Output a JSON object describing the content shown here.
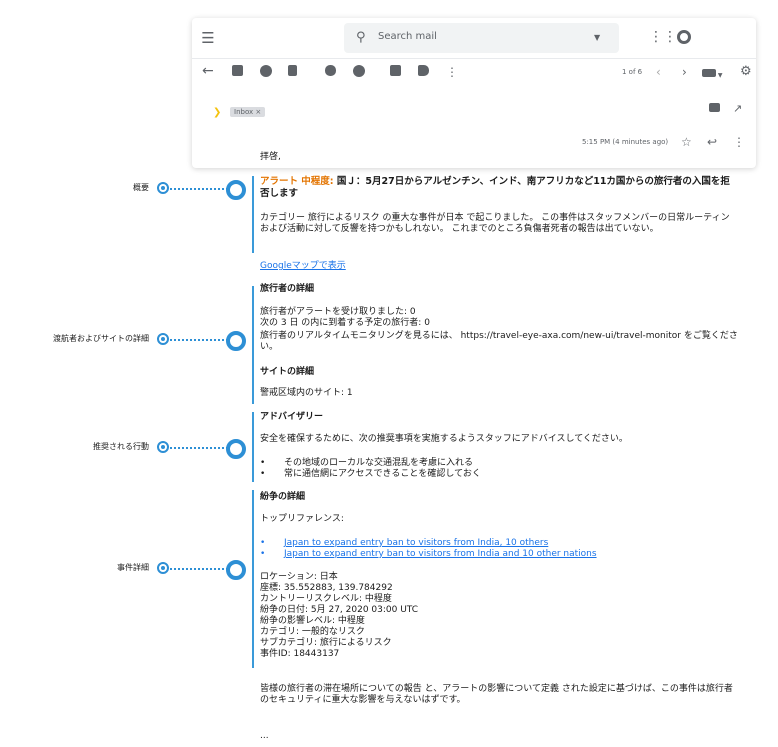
{
  "search": {
    "placeholder": "Search mail"
  },
  "toolbar": {
    "page_count": "1 of 6"
  },
  "email": {
    "label_badge": "Inbox ×",
    "timestamp": "5:15 PM (4 minutes ago)",
    "greeting": "拝啓,",
    "alert_level": "アラート 中程度:",
    "alert_title": " 国Ｊ：5月27日からアルゼンチン、インド、南アフリカなど11カ国からの旅行者の入国を拒否します",
    "summary": "カテゴリー 旅行によるリスク の重大な事件が日本 で起こりました。 この事件はスタッフメンバーの日常ルーティンおよび活動に対して反響を持つかもしれない。 これまでのところ負傷者死者の報告は出ていない。",
    "maps_link": "Googleマップで表示",
    "traveler_heading": "旅行者の詳細",
    "traveler_lines": [
      "旅行者がアラートを受け取りました: 0",
      "次の 3 日 の内に到着する予定の旅行者: 0",
      "旅行者のリアルタイムモニタリングを見るには、 https://travel-eye-axa.com/new-ui/travel-monitor をご覧ください。"
    ],
    "site_heading": "サイトの詳細",
    "site_line": "警戒区域内のサイト: 1",
    "advisory_heading": "アドバイザリー",
    "advisory_text": "安全を確保するために、次の推奨事項を実施するようスタッフにアドバイスしてください。",
    "advisory_items": [
      "その地域のローカルな交通混乱を考慮に入れる",
      "常に通信網にアクセスできることを確認しておく"
    ],
    "conflict_heading": "紛争の詳細",
    "top_ref_label": "トップリファレンス:",
    "references": [
      "Japan to expand entry ban to visitors from India, 10 others",
      "Japan to expand entry ban to visitors from India and 10 other nations"
    ],
    "details": [
      "ロケーション: 日本",
      "座標: 35.552883, 139.784292",
      "カントリーリスクレベル: 中程度",
      "紛争の日付:  5月 27, 2020 03:00 UTC",
      "紛争の影響レベル: 中程度",
      "カテゴリ: 一般的なリスク",
      "サブカテゴリ: 旅行によるリスク",
      "事件ID: 18443137"
    ],
    "closing": "皆様の旅行者の滞在場所についての報告 と、アラートの影響について定義 された設定に基づけば、この事件は旅行者のセキュリティに重大な影響を与えないはずです。",
    "ellipsis": "..."
  },
  "annotations": [
    "概要",
    "渡航者およびサイトの詳細",
    "推奨される行動",
    "事件詳細"
  ],
  "colors": {
    "accent": "#2d8fd5",
    "alert": "#e37400",
    "link": "#1a73e8"
  }
}
